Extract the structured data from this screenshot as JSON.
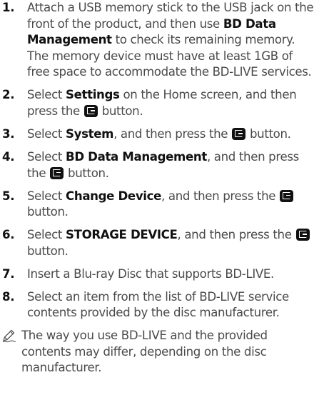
{
  "steps": [
    {
      "number": "1.",
      "parts": [
        {
          "text": "Attach a USB memory stick to the USB jack on the front of the product, and then use "
        },
        {
          "text": "BD Data Management",
          "bold": true
        },
        {
          "text": " to check its remaining memory. The memory device must have at least 1GB of free space to accommodate the BD-LIVE services."
        }
      ]
    },
    {
      "number": "2.",
      "parts": [
        {
          "text": "Select "
        },
        {
          "text": "Settings",
          "bold": true
        },
        {
          "text": " on the Home screen, and then press the "
        },
        {
          "icon": "enter-button-icon"
        },
        {
          "text": " button."
        }
      ]
    },
    {
      "number": "3.",
      "parts": [
        {
          "text": "Select "
        },
        {
          "text": "System",
          "bold": true
        },
        {
          "text": ", and then press the "
        },
        {
          "icon": "enter-button-icon"
        },
        {
          "text": " button."
        }
      ]
    },
    {
      "number": "4.",
      "parts": [
        {
          "text": "Select "
        },
        {
          "text": "BD Data Management",
          "bold": true
        },
        {
          "text": ", and then press the "
        },
        {
          "icon": "enter-button-icon"
        },
        {
          "text": " button."
        }
      ]
    },
    {
      "number": "5.",
      "parts": [
        {
          "text": "Select "
        },
        {
          "text": "Change Device",
          "bold": true
        },
        {
          "text": ", and then press the "
        },
        {
          "icon": "enter-button-icon"
        },
        {
          "text": " button."
        }
      ]
    },
    {
      "number": "6.",
      "parts": [
        {
          "text": "Select "
        },
        {
          "text": "STORAGE DEVICE",
          "bold": true
        },
        {
          "text": ", and then press the "
        },
        {
          "icon": "enter-button-icon"
        },
        {
          "text": " button."
        }
      ]
    },
    {
      "number": "7.",
      "parts": [
        {
          "text": "Insert a Blu-ray Disc that supports BD-LIVE."
        }
      ]
    },
    {
      "number": "8.",
      "parts": [
        {
          "text": "Select an item from the list of BD-LIVE service contents provided by the disc manufacturer."
        }
      ]
    }
  ],
  "note": {
    "icon": "pencil-note-icon",
    "text": "The way you use BD-LIVE and the provided contents may differ, depending on the disc manufacturer."
  },
  "colors": {
    "text": "#4a4a4a",
    "bold": "#111111",
    "icon_bg": "#111111"
  }
}
